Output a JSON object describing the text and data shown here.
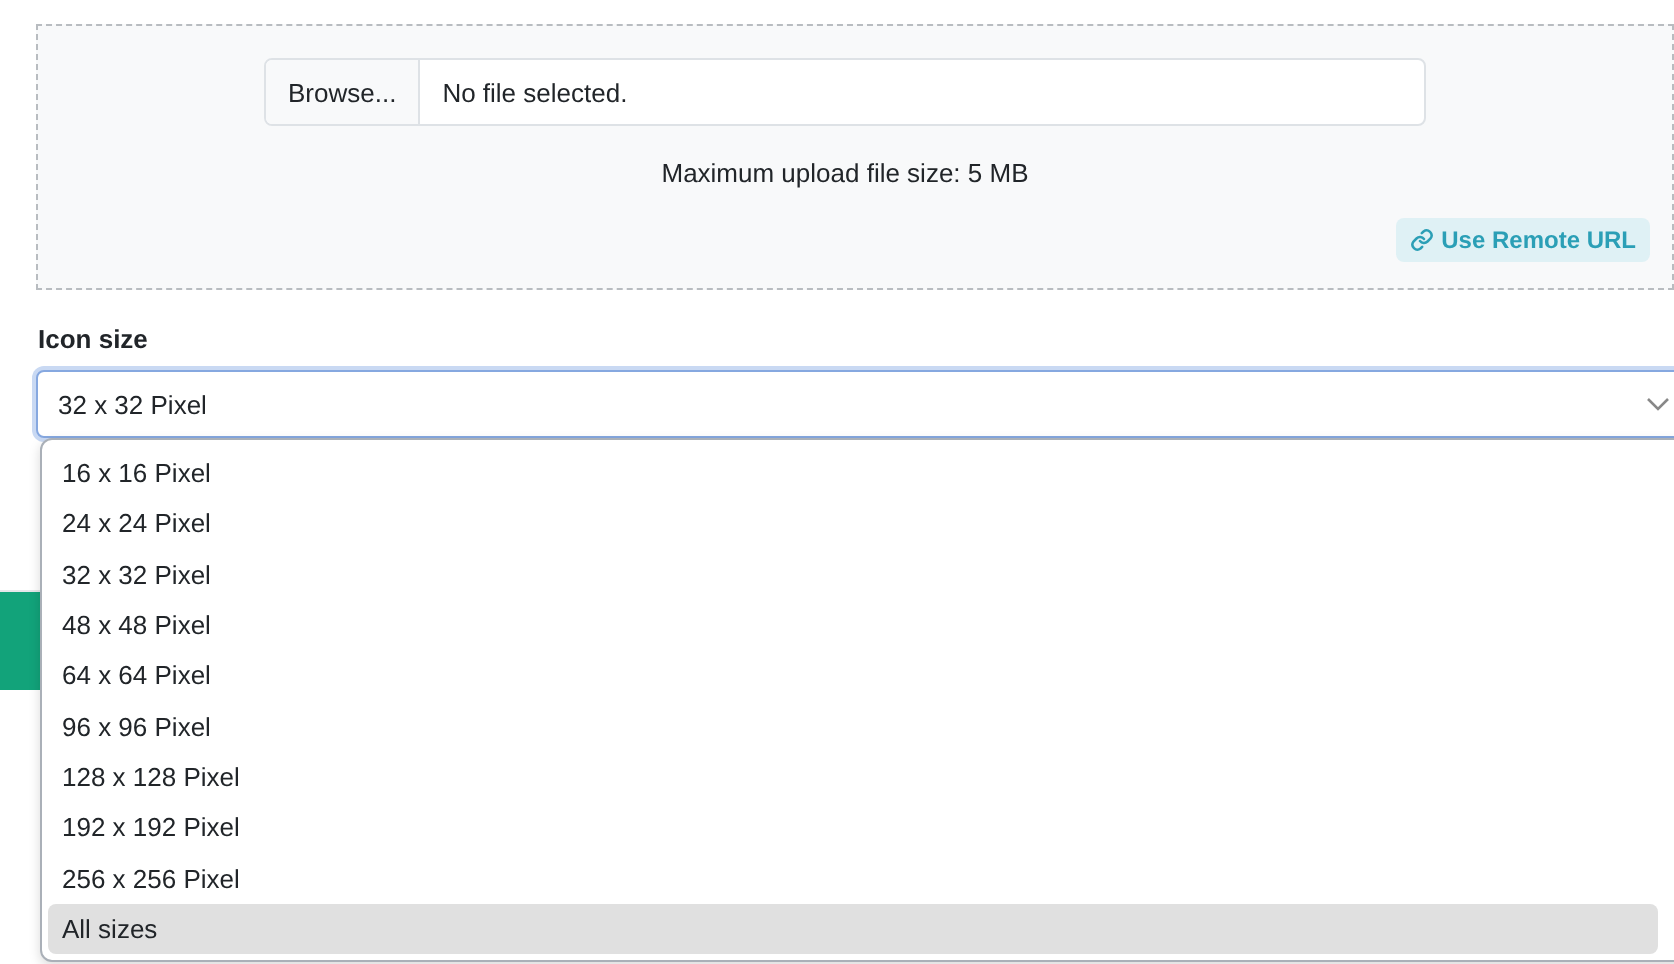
{
  "upload": {
    "browse_button": "Browse...",
    "file_name": "No file selected.",
    "note": "Maximum upload file size: 5 MB",
    "remote_button": "Use Remote URL"
  },
  "icon_size": {
    "label": "Icon size",
    "value": "32 x 32 Pixel",
    "expanded": true,
    "options": [
      {
        "label": "16 x 16 Pixel",
        "highlighted": false
      },
      {
        "label": "24 x 24 Pixel",
        "highlighted": false
      },
      {
        "label": "32 x 32 Pixel",
        "highlighted": false
      },
      {
        "label": "48 x 48 Pixel",
        "highlighted": false
      },
      {
        "label": "64 x 64 Pixel",
        "highlighted": false
      },
      {
        "label": "96 x 96 Pixel",
        "highlighted": false
      },
      {
        "label": "128 x 128 Pixel",
        "highlighted": false
      },
      {
        "label": "192 x 192 Pixel",
        "highlighted": false
      },
      {
        "label": "256 x 256 Pixel",
        "highlighted": false
      },
      {
        "label": "All sizes",
        "highlighted": true
      }
    ]
  }
}
